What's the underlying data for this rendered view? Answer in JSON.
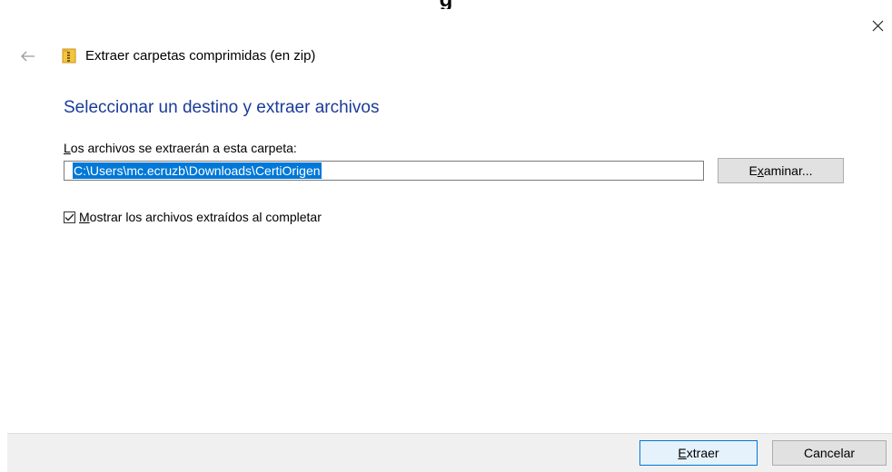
{
  "window": {
    "title": "Extraer carpetas comprimidas (en zip)",
    "close_icon": "close-icon",
    "back_icon": "back-arrow-icon",
    "title_icon": "zip-folder-icon"
  },
  "top_cut_text": "g",
  "main": {
    "heading": "Seleccionar un destino y extraer archivos",
    "destination_label_mnemonic": "L",
    "destination_label_rest": "os archivos se extraerán a esta carpeta:",
    "destination_path": "C:\\Users\\mc.ecruzb\\Downloads\\CertiOrigen",
    "browse_mnemonic_pre": "E",
    "browse_mnemonic": "x",
    "browse_rest": "aminar...",
    "show_files_checked": true,
    "show_files_mnemonic": "M",
    "show_files_rest": "ostrar los archivos extraídos al completar"
  },
  "footer": {
    "extract_mnemonic": "E",
    "extract_rest": "xtraer",
    "cancel_label": "Cancelar"
  },
  "colors": {
    "heading": "#1a3c99",
    "selection": "#0078d7",
    "footer_bg": "#f0f0f0"
  }
}
